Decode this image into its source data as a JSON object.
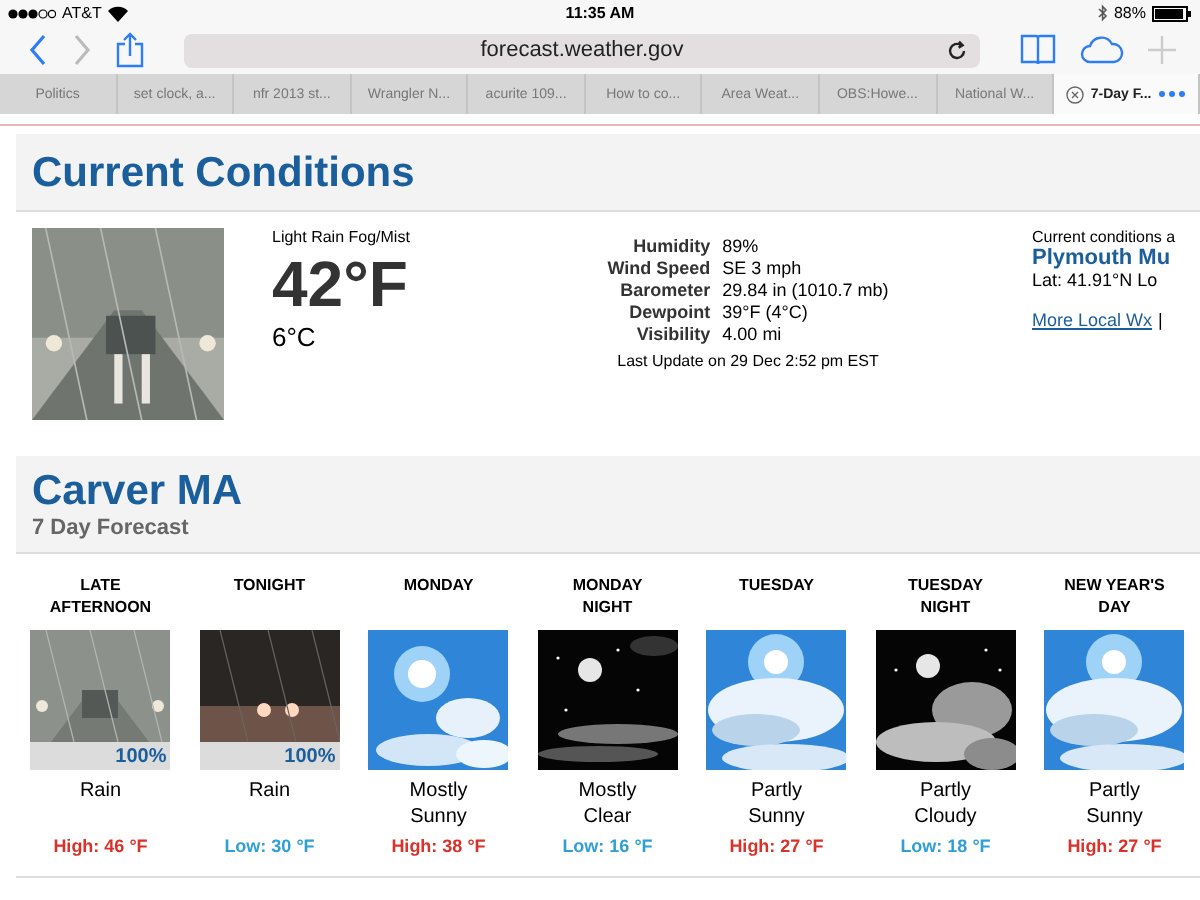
{
  "status_bar": {
    "carrier": "AT&T",
    "time": "11:35 AM",
    "battery": "88%"
  },
  "toolbar": {
    "url": "forecast.weather.gov"
  },
  "tabs": [
    {
      "label": "Politics",
      "selected": false
    },
    {
      "label": "set clock, a...",
      "selected": false
    },
    {
      "label": "nfr 2013 st...",
      "selected": false
    },
    {
      "label": "Wrangler N...",
      "selected": false
    },
    {
      "label": "acurite 109...",
      "selected": false
    },
    {
      "label": "How to co...",
      "selected": false
    },
    {
      "label": "Area Weat...",
      "selected": false
    },
    {
      "label": "OBS:Howe...",
      "selected": false
    },
    {
      "label": "National W...",
      "selected": false
    },
    {
      "label": "7-Day F...",
      "selected": true
    }
  ],
  "current": {
    "title": "Current Conditions",
    "summary": "Light Rain Fog/Mist",
    "temp_f": "42°F",
    "temp_c": "6°C",
    "details": [
      {
        "label": "Humidity",
        "value": "89%"
      },
      {
        "label": "Wind Speed",
        "value": "SE 3 mph"
      },
      {
        "label": "Barometer",
        "value": "29.84 in (1010.7 mb)"
      },
      {
        "label": "Dewpoint",
        "value": "39°F (4°C)"
      },
      {
        "label": "Visibility",
        "value": "4.00 mi"
      }
    ],
    "last_update": "Last Update on 29 Dec 2:52 pm EST",
    "station_intro": "Current conditions a",
    "station": "Plymouth Mu",
    "coords": "Lat: 41.91°N Lo",
    "more_link": "More Local Wx",
    "separator": "|"
  },
  "forecast": {
    "location": "Carver MA",
    "subtitle": "7 Day Forecast",
    "periods": [
      {
        "name": [
          "LATE",
          "AFTERNOON"
        ],
        "chance": "100%",
        "short": [
          "Rain"
        ],
        "temp": {
          "text": "High: 46 °F",
          "kind": "high"
        }
      },
      {
        "name": [
          "TONIGHT"
        ],
        "chance": "100%",
        "short": [
          "Rain"
        ],
        "temp": {
          "text": "Low: 30 °F",
          "kind": "low"
        }
      },
      {
        "name": [
          "MONDAY"
        ],
        "short": [
          "Mostly",
          "Sunny"
        ],
        "temp": {
          "text": "High: 38 °F",
          "kind": "high"
        }
      },
      {
        "name": [
          "MONDAY",
          "NIGHT"
        ],
        "short": [
          "Mostly",
          "Clear"
        ],
        "temp": {
          "text": "Low: 16 °F",
          "kind": "low"
        }
      },
      {
        "name": [
          "TUESDAY"
        ],
        "short": [
          "Partly",
          "Sunny"
        ],
        "temp": {
          "text": "High: 27 °F",
          "kind": "high"
        }
      },
      {
        "name": [
          "TUESDAY",
          "NIGHT"
        ],
        "short": [
          "Partly",
          "Cloudy"
        ],
        "temp": {
          "text": "Low: 18 °F",
          "kind": "low"
        }
      },
      {
        "name": [
          "NEW YEAR'S",
          "DAY"
        ],
        "short": [
          "Partly",
          "Sunny"
        ],
        "temp": {
          "text": "High: 27 °F",
          "kind": "high"
        }
      }
    ]
  }
}
